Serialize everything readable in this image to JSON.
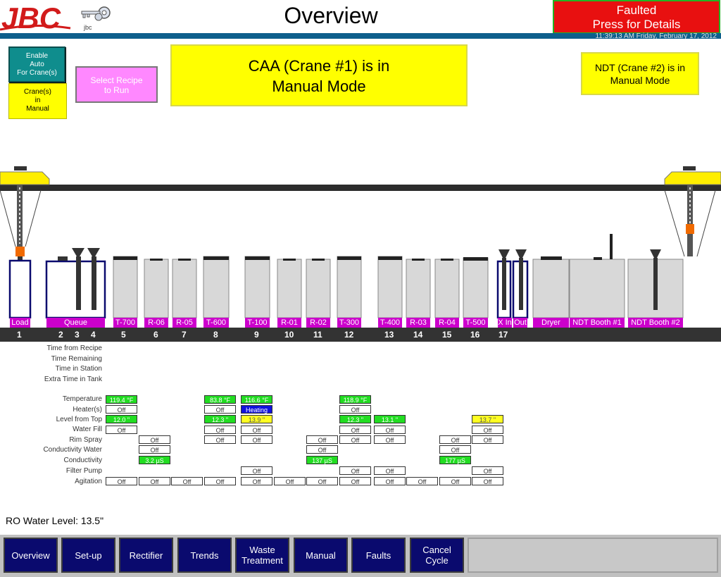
{
  "header": {
    "logo_text": "JBC",
    "logo_sub": "jbc",
    "title": "Overview",
    "fault_line1": "Faulted",
    "fault_line2": "Press for Details",
    "datetime": "11:39:13 AM Friday, February 17, 2012"
  },
  "controls": {
    "enable_auto": [
      "Enable",
      "Auto",
      "For Crane(s)"
    ],
    "crane_manual": [
      "Crane(s)",
      "in",
      "Manual"
    ],
    "select_recipe": [
      "Select Recipe",
      "to Run"
    ],
    "caa_status": [
      "CAA (Crane #1) is in",
      "Manual Mode"
    ],
    "ndt_status": [
      "NDT (Crane #2) is in",
      "Manual Mode"
    ]
  },
  "stations": {
    "labels": [
      "Load",
      "Queue",
      "T-700",
      "R-06",
      "R-05",
      "T-600",
      "T-100",
      "R-01",
      "R-02",
      "T-300",
      "T-400",
      "R-03",
      "R-04",
      "T-500",
      "X In",
      "Out",
      "Dryer",
      "NDT Booth #1",
      "NDT Booth #2"
    ],
    "numbers": [
      "1",
      "2",
      "3",
      "4",
      "5",
      "6",
      "7",
      "8",
      "9",
      "10",
      "11",
      "12",
      "13",
      "14",
      "15",
      "16",
      "17"
    ]
  },
  "time_labels": [
    "Time from Recipe",
    "Time Remaining",
    "Time in Station",
    "Extra Time in Tank"
  ],
  "row_labels": [
    "Temperature",
    "Heater(s)",
    "Level from Top",
    "Water Fill",
    "Rim Spray",
    "Conductivity Water",
    "Conductivity",
    "Filter Pump",
    "Agitation"
  ],
  "cells": {
    "temperature": [
      "119.4 °F",
      "83.8 °F",
      "116.6 °F",
      "118.9 °F"
    ],
    "heaters": [
      "Off",
      "Off",
      "Heating",
      "Off"
    ],
    "level": [
      "12.0 \"",
      "12.3 \"",
      "13.9 \"",
      "12.3 \"",
      "13.1 \"",
      "13.7 \""
    ],
    "water_fill": [
      "Off",
      "Off",
      "Off",
      "Off",
      "Off",
      "Off"
    ],
    "rim_spray": [
      "Off",
      "Off",
      "Off",
      "Off",
      "Off",
      "Off",
      "Off",
      "Off"
    ],
    "conductivity_water": [
      "Off",
      "Off",
      "Off"
    ],
    "conductivity": [
      "3.2 µS",
      "137 µS",
      "177 µS"
    ],
    "filter_pump": [
      "Off",
      "Off",
      "Off",
      "Off"
    ],
    "agitation": [
      "Off",
      "Off",
      "Off",
      "Off",
      "Off",
      "Off",
      "Off",
      "Off",
      "Off",
      "Off",
      "Off",
      "Off"
    ]
  },
  "ro_water": "RO Water Level: 13.5\"",
  "nav": [
    "Overview",
    "Set-up",
    "Rectifier",
    "Trends",
    "Waste Treatment",
    "Manual",
    "Faults",
    "Cancel Cycle"
  ],
  "colors": {
    "ok_green": "#22dd22",
    "warn_yellow": "#ffff22",
    "heating_blue": "#1010dd",
    "fault_red": "#e81010",
    "station_magenta": "#cc00cc",
    "nav_navy": "#0a0a6e"
  }
}
